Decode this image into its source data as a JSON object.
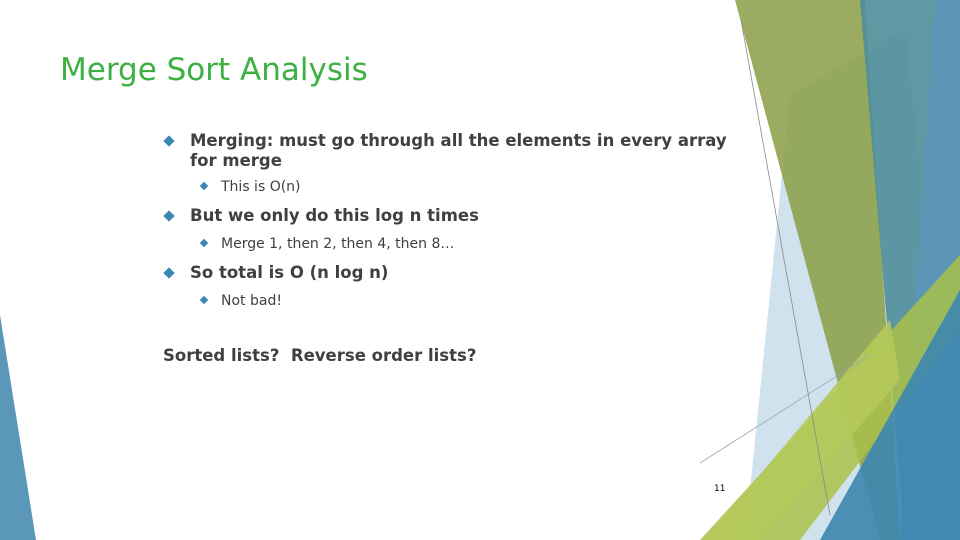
{
  "slide": {
    "title": "Merge Sort Analysis",
    "bullets": [
      {
        "text": "Merging: must go through all the elements in every array for merge",
        "line1": "Merging: must go through all the elements in every array",
        "line2": "for merge",
        "sub": [
          "This is O(n)"
        ]
      },
      {
        "text": "But we only do this log n times",
        "sub": [
          "Merge 1, then 2, then 4, then 8…"
        ]
      },
      {
        "text": "So total is O (n log n)",
        "sub": [
          "Not bad!"
        ]
      }
    ],
    "closing_text": "Sorted lists?  Reverse order lists?",
    "page_number": "11"
  },
  "theme": {
    "title_color": "#3cb043",
    "bullet_color": "#3a86b4",
    "text_color": "#404040"
  }
}
